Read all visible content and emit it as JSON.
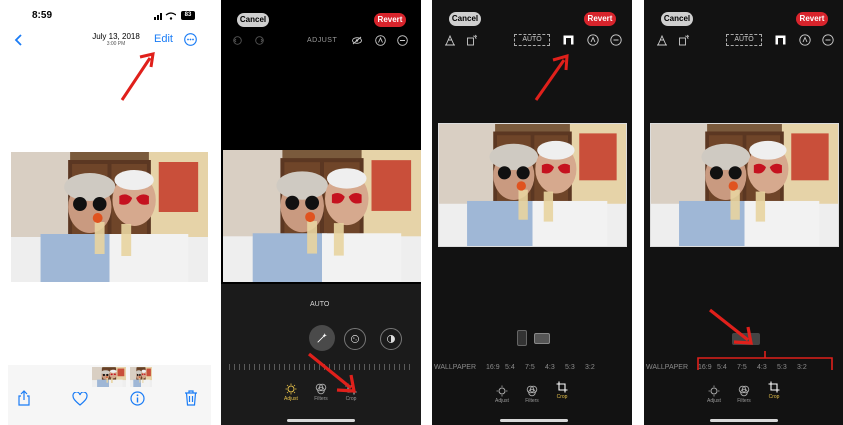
{
  "panel1": {
    "status_time": "8:59",
    "battery": "83",
    "date": "July 13, 2018",
    "time": "3:00 PM",
    "edit_label": "Edit"
  },
  "panel2": {
    "cancel_label": "Cancel",
    "revert_label": "Revert",
    "mode_label": "ADJUST",
    "auto_label": "AUTO",
    "tools": [
      "Adjust",
      "Filters",
      "Crop"
    ]
  },
  "panel3": {
    "cancel_label": "Cancel",
    "revert_label": "Revert",
    "auto_label": "AUTO",
    "ratios": [
      "WALLPAPER",
      "16:9",
      "5:4",
      "7:5",
      "4:3",
      "5:3",
      "3:2"
    ],
    "tools": [
      "Adjust",
      "Filters",
      "Crop"
    ]
  },
  "panel4": {
    "cancel_label": "Cancel",
    "revert_label": "Revert",
    "auto_label": "AUTO",
    "ratios": [
      "WALLPAPER",
      "16:9",
      "5:4",
      "7:5",
      "4:3",
      "5:3",
      "3:2"
    ],
    "tools": [
      "Adjust",
      "Filters",
      "Crop"
    ]
  },
  "colors": {
    "ios_blue": "#1a7cf5",
    "revert_red": "#d8242c",
    "annotation_red": "#e0201b",
    "active_tool_yellow": "#e5c04a"
  }
}
